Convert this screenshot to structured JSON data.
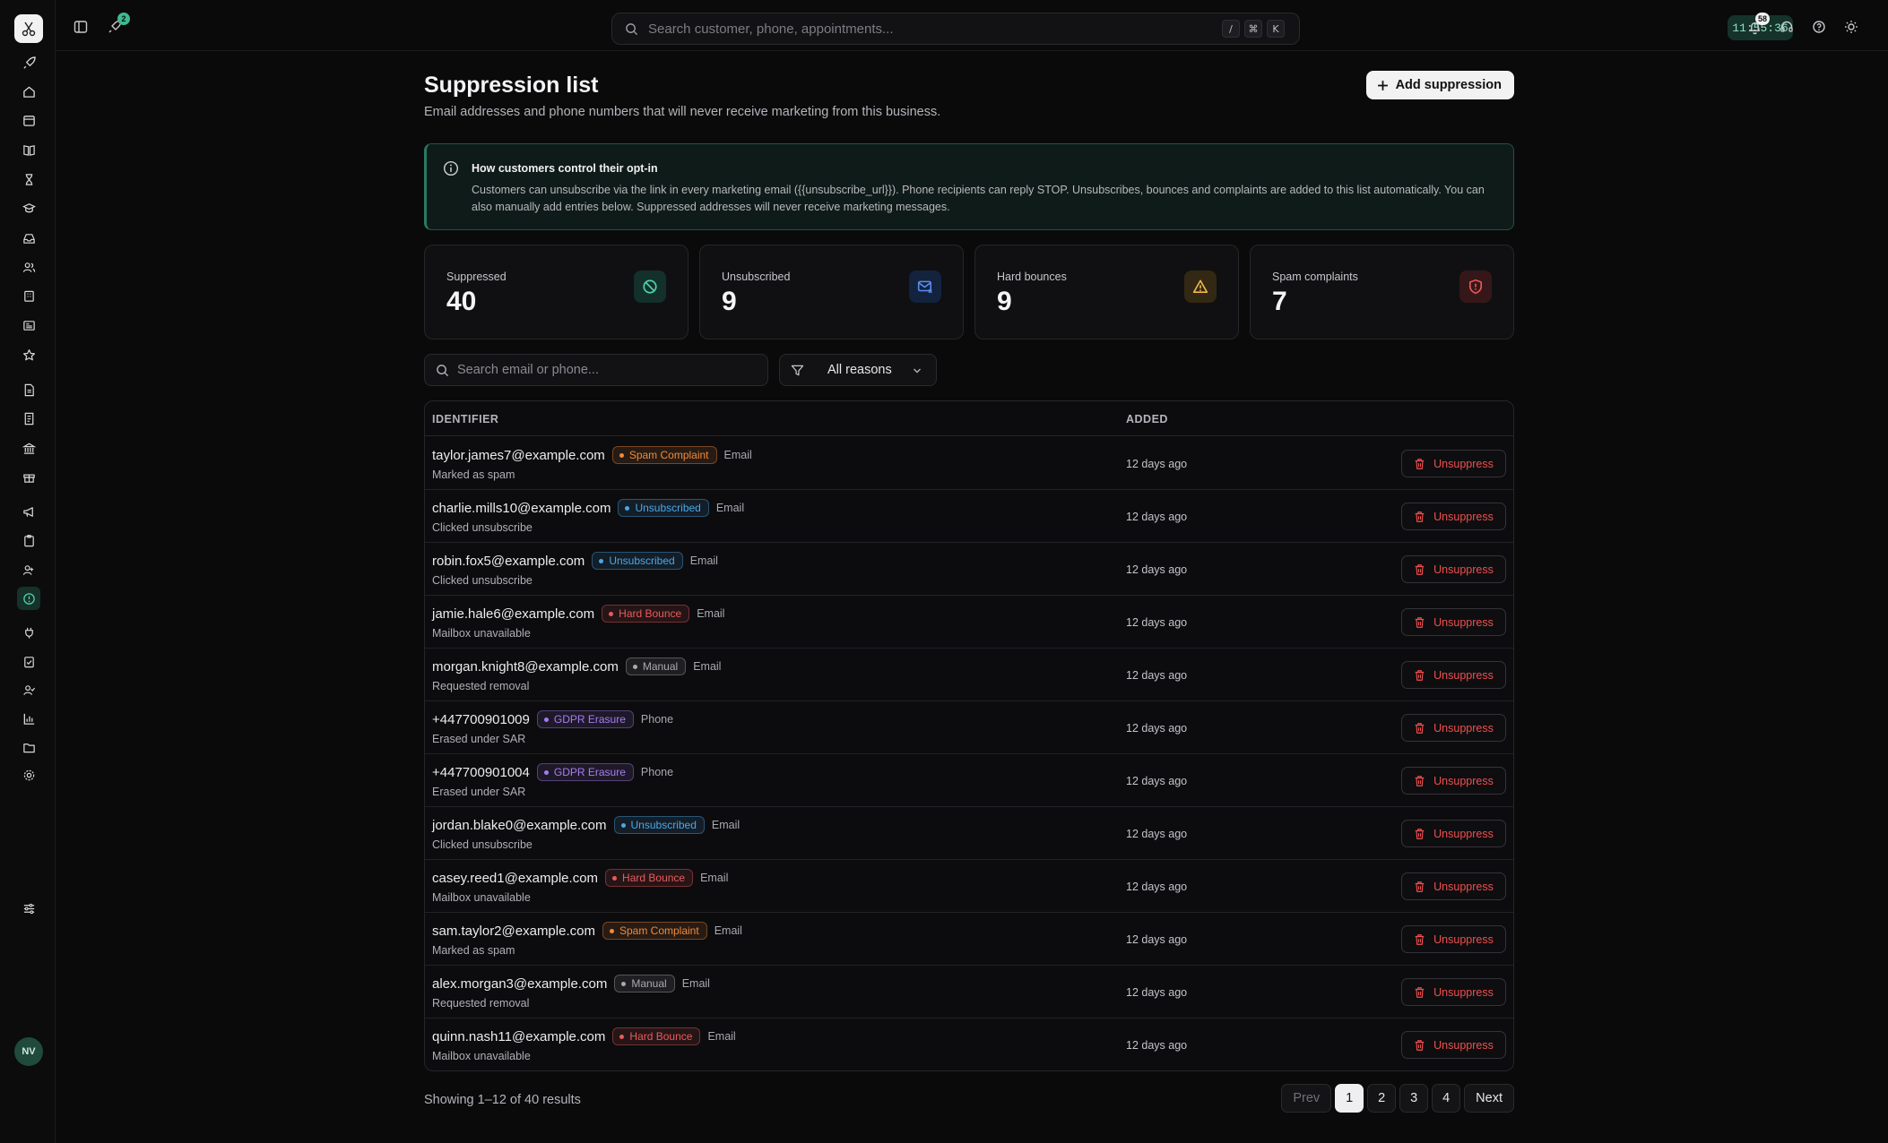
{
  "colors": {
    "accent": "#4fd1a5",
    "danger": "#ef4f4f",
    "badge_spam": "#f08a3c",
    "badge_unsub": "#4aa8e8",
    "badge_bounce": "#ea5a5a",
    "badge_manual": "#a9a9b0",
    "badge_gdpr": "#a77cf0"
  },
  "topbar": {
    "rocket_badge": "2",
    "search_placeholder": "Search customer, phone, appointments...",
    "kbd": [
      "/",
      "⌘",
      "K"
    ],
    "clock": "11:55:36",
    "notifications_count": "58"
  },
  "sidebar": {
    "avatar_initials": "NV",
    "icons": [
      "rocket-icon",
      "home-icon",
      "calendar-icon",
      "book-icon",
      "hourglass-icon",
      "graduation-cap-icon",
      "inbox-icon",
      "users-icon",
      "building-icon",
      "newspaper-icon",
      "star-icon",
      "file-text-icon",
      "receipt-icon",
      "bank-icon",
      "gift-icon",
      "megaphone-icon",
      "clipboard-icon",
      "team-icon",
      "suppression-icon",
      "integrations-icon",
      "clipboard-check-icon",
      "user-check-icon",
      "bar-chart-icon",
      "folder-icon",
      "settings-icon",
      "sliders-icon"
    ]
  },
  "page": {
    "title": "Suppression list",
    "subtitle": "Email addresses and phone numbers that will never receive marketing from this business.",
    "add_button": "Add suppression"
  },
  "info": {
    "title": "How customers control their opt-in",
    "body": "Customers can unsubscribe via the link in every marketing email ({{unsubscribe_url}}). Phone recipients can reply STOP. Unsubscribes, bounces and complaints are added to this list automatically. You can also manually add entries below. Suppressed addresses will never receive marketing messages."
  },
  "stats": [
    {
      "label": "Suppressed",
      "value": "40"
    },
    {
      "label": "Unsubscribed",
      "value": "9"
    },
    {
      "label": "Hard bounces",
      "value": "9"
    },
    {
      "label": "Spam complaints",
      "value": "7"
    }
  ],
  "filters": {
    "search_placeholder": "Search email or phone...",
    "reason_selected": "All reasons"
  },
  "table": {
    "headers": {
      "identifier": "IDENTIFIER",
      "added": "ADDED"
    },
    "action_label": "Unsuppress",
    "rows": [
      {
        "identifier": "taylor.james7@example.com",
        "reason": "Spam Complaint",
        "reason_key": "spam",
        "channel": "Email",
        "note": "Marked as spam",
        "added": "12 days ago"
      },
      {
        "identifier": "charlie.mills10@example.com",
        "reason": "Unsubscribed",
        "reason_key": "unsub",
        "channel": "Email",
        "note": "Clicked unsubscribe",
        "added": "12 days ago"
      },
      {
        "identifier": "robin.fox5@example.com",
        "reason": "Unsubscribed",
        "reason_key": "unsub",
        "channel": "Email",
        "note": "Clicked unsubscribe",
        "added": "12 days ago"
      },
      {
        "identifier": "jamie.hale6@example.com",
        "reason": "Hard Bounce",
        "reason_key": "bounce",
        "channel": "Email",
        "note": "Mailbox unavailable",
        "added": "12 days ago"
      },
      {
        "identifier": "morgan.knight8@example.com",
        "reason": "Manual",
        "reason_key": "manual",
        "channel": "Email",
        "note": "Requested removal",
        "added": "12 days ago"
      },
      {
        "identifier": "+447700901009",
        "reason": "GDPR Erasure",
        "reason_key": "gdpr",
        "channel": "Phone",
        "note": "Erased under SAR",
        "added": "12 days ago"
      },
      {
        "identifier": "+447700901004",
        "reason": "GDPR Erasure",
        "reason_key": "gdpr",
        "channel": "Phone",
        "note": "Erased under SAR",
        "added": "12 days ago"
      },
      {
        "identifier": "jordan.blake0@example.com",
        "reason": "Unsubscribed",
        "reason_key": "unsub",
        "channel": "Email",
        "note": "Clicked unsubscribe",
        "added": "12 days ago"
      },
      {
        "identifier": "casey.reed1@example.com",
        "reason": "Hard Bounce",
        "reason_key": "bounce",
        "channel": "Email",
        "note": "Mailbox unavailable",
        "added": "12 days ago"
      },
      {
        "identifier": "sam.taylor2@example.com",
        "reason": "Spam Complaint",
        "reason_key": "spam",
        "channel": "Email",
        "note": "Marked as spam",
        "added": "12 days ago"
      },
      {
        "identifier": "alex.morgan3@example.com",
        "reason": "Manual",
        "reason_key": "manual",
        "channel": "Email",
        "note": "Requested removal",
        "added": "12 days ago"
      },
      {
        "identifier": "quinn.nash11@example.com",
        "reason": "Hard Bounce",
        "reason_key": "bounce",
        "channel": "Email",
        "note": "Mailbox unavailable",
        "added": "12 days ago"
      }
    ]
  },
  "pagination": {
    "summary": "Showing 1–12 of 40 results",
    "prev": "Prev",
    "next": "Next",
    "pages": [
      "1",
      "2",
      "3",
      "4"
    ],
    "current": "1"
  }
}
